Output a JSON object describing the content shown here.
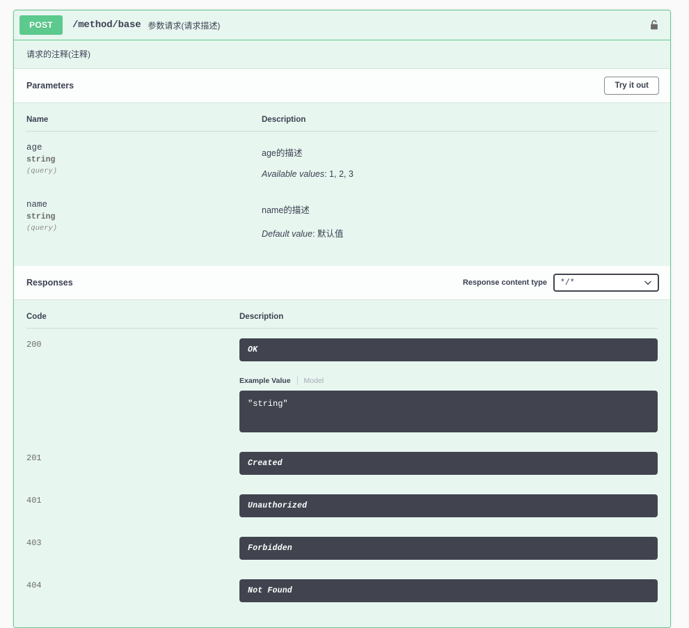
{
  "operation": {
    "method": "POST",
    "path": "/method/base",
    "summary": "参数请求(请求描述)",
    "description": "请求的注释(注释)",
    "lock_icon": "lock-icon"
  },
  "parameters_section": {
    "title": "Parameters",
    "try_it_out_label": "Try it out",
    "columns": {
      "name": "Name",
      "description": "Description"
    },
    "rows": [
      {
        "name": "age",
        "type": "string",
        "in": "(query)",
        "description": "age的描述",
        "meta_label": "Available values",
        "meta_value": ": 1, 2, 3"
      },
      {
        "name": "name",
        "type": "string",
        "in": "(query)",
        "description": "name的描述",
        "meta_label": "Default value",
        "meta_value": ": 默认值"
      }
    ]
  },
  "responses_section": {
    "title": "Responses",
    "content_type_label": "Response content type",
    "content_type_value": "*/*",
    "chevron_icon": "chevron-down-icon",
    "columns": {
      "code": "Code",
      "description": "Description"
    },
    "rows": [
      {
        "code": "200",
        "description": "OK",
        "example_tabs": {
          "active": "Example Value",
          "inactive": "Model"
        },
        "example_value": "\"string\""
      },
      {
        "code": "201",
        "description": "Created"
      },
      {
        "code": "401",
        "description": "Unauthorized"
      },
      {
        "code": "403",
        "description": "Forbidden"
      },
      {
        "code": "404",
        "description": "Not Found"
      }
    ]
  },
  "colors": {
    "method_green": "#5cc98d",
    "block_border": "#62c98e",
    "block_bg": "#e8f6f0",
    "dark_block": "#41444e",
    "text": "#3b4151"
  }
}
